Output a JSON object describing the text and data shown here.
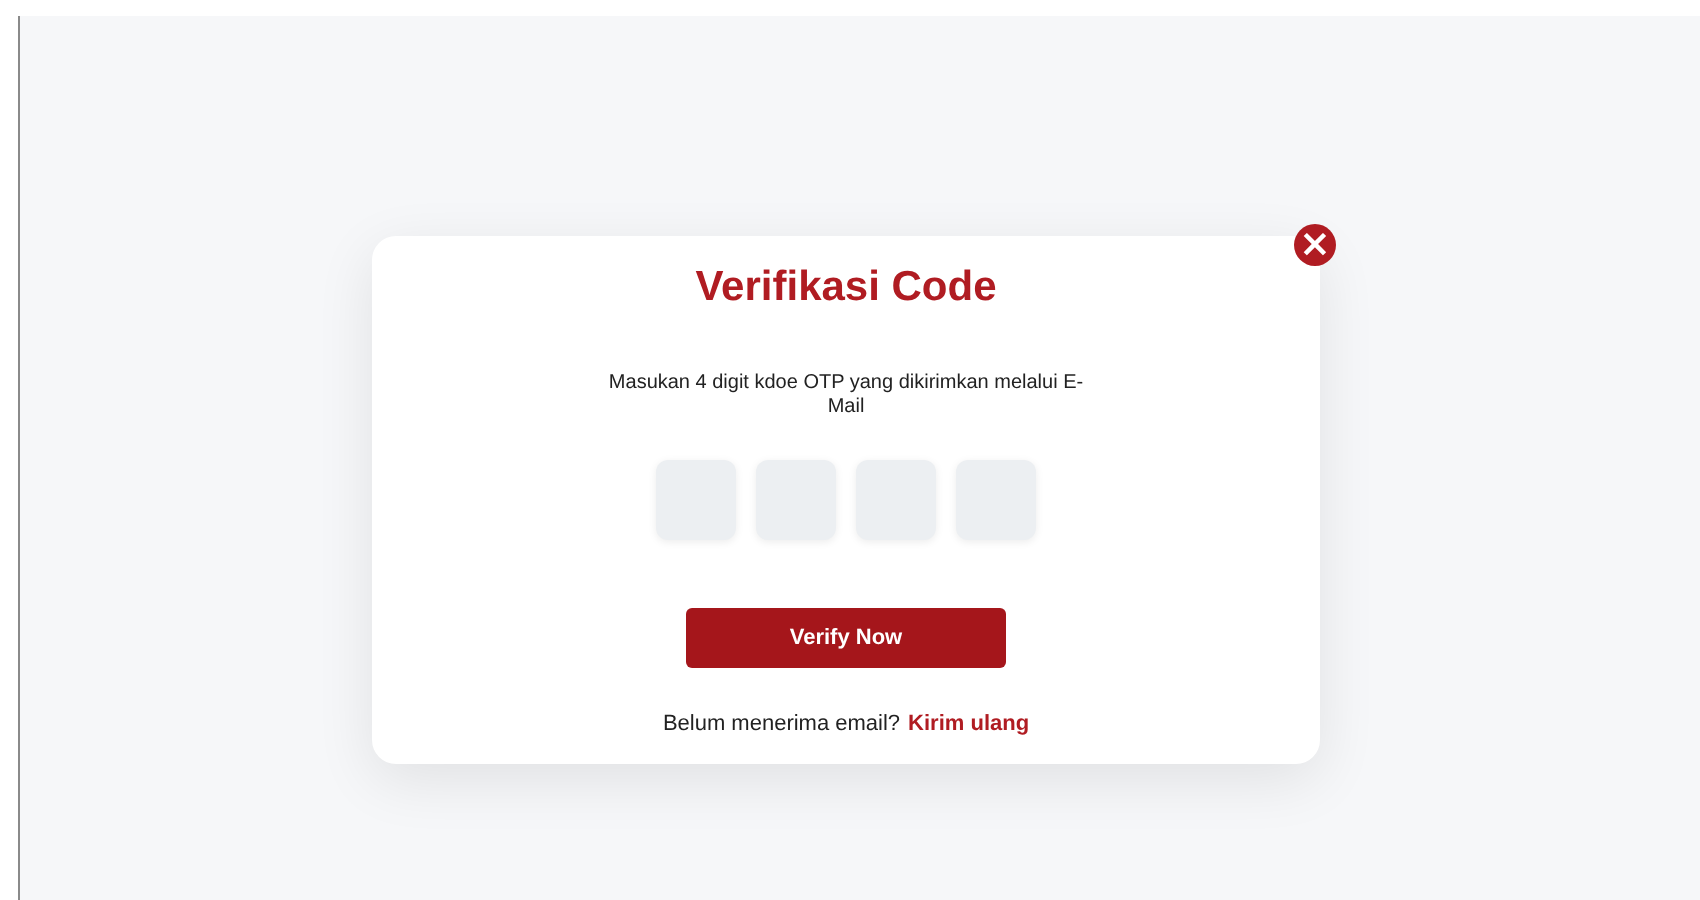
{
  "dialog": {
    "title": "Verifikasi Code",
    "instruction": "Masukan 4 digit kdoe OTP yang dikirimkan melalui E-Mail",
    "otp_fields": [
      {
        "filled": false
      },
      {
        "filled": false
      },
      {
        "filled": false
      },
      {
        "filled": false
      }
    ],
    "submit_button": "Verify Now",
    "resend_prompt": "Belum menerima email?",
    "resend_link": "Kirim ulang",
    "close_icon": "×"
  }
}
